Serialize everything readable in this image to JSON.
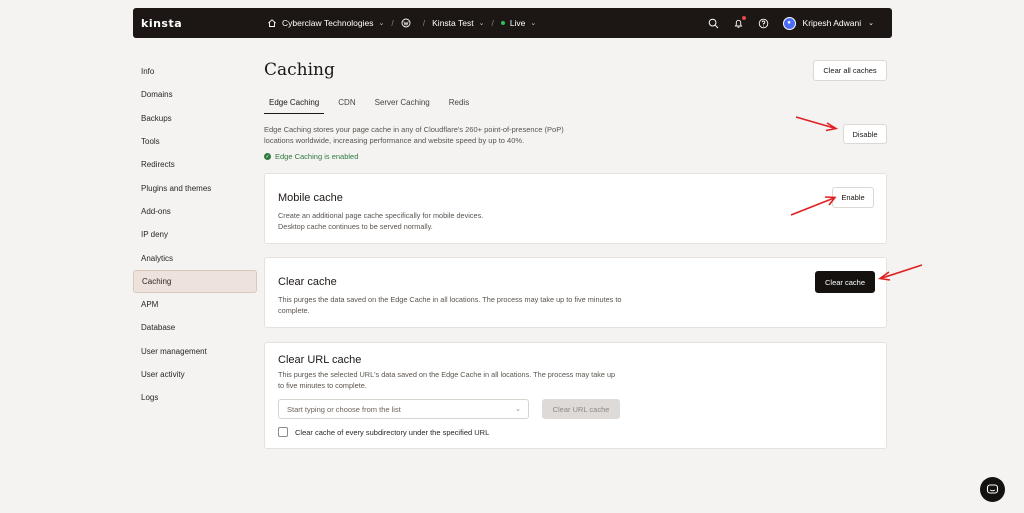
{
  "topbar": {
    "logo": "kinsta",
    "company": "Cyberclaw Technologies",
    "site": "Kinsta Test",
    "environment": "Live",
    "user_name": "Kripesh Adwani",
    "separator": "/"
  },
  "sidebar": {
    "items": [
      {
        "label": "Info"
      },
      {
        "label": "Domains"
      },
      {
        "label": "Backups"
      },
      {
        "label": "Tools"
      },
      {
        "label": "Redirects"
      },
      {
        "label": "Plugins and themes"
      },
      {
        "label": "Add-ons"
      },
      {
        "label": "IP deny"
      },
      {
        "label": "Analytics"
      },
      {
        "label": "Caching"
      },
      {
        "label": "APM"
      },
      {
        "label": "Database"
      },
      {
        "label": "User management"
      },
      {
        "label": "User activity"
      },
      {
        "label": "Logs"
      }
    ],
    "active": "Caching"
  },
  "main": {
    "title": "Caching",
    "clear_all_label": "Clear all caches",
    "tabs": [
      {
        "label": "Edge Caching"
      },
      {
        "label": "CDN"
      },
      {
        "label": "Server Caching"
      },
      {
        "label": "Redis"
      }
    ],
    "description": "Edge Caching stores your page cache in any of Cloudflare's 260+ point-of-presence (PoP) locations worldwide, increasing performance and website speed by up to 40%.",
    "disable_label": "Disable",
    "status_text": "Edge Caching is enabled"
  },
  "mobile_cache": {
    "title": "Mobile cache",
    "text_line1": "Create an additional page cache specifically for mobile devices.",
    "text_line2": "Desktop cache continues to be served normally.",
    "button_label": "Enable"
  },
  "clear_cache": {
    "title": "Clear cache",
    "text": "This purges the data saved on the Edge Cache in all locations. The process may take up to five minutes to complete.",
    "button_label": "Clear cache"
  },
  "clear_url_cache": {
    "title": "Clear URL cache",
    "text": "This purges the selected URL's data saved on the Edge Cache in all locations. The process may take up to five minutes to complete.",
    "select_placeholder": "Start typing or choose from the list",
    "button_label": "Clear URL cache",
    "checkbox_label": "Clear cache of every subdirectory under the specified URL"
  },
  "colors": {
    "topbar_bg": "#1c1714",
    "accent_dark": "#15110f",
    "success": "#2d7a3f",
    "annotation_arrow": "#e02020",
    "live_dot": "#2fbf5a"
  },
  "icons": [
    "home-icon",
    "wordpress-icon",
    "search-icon",
    "bell-icon",
    "help-icon",
    "avatar",
    "chevron-down-icon",
    "check-circle-icon",
    "chat-icon",
    "annotation-arrow"
  ]
}
